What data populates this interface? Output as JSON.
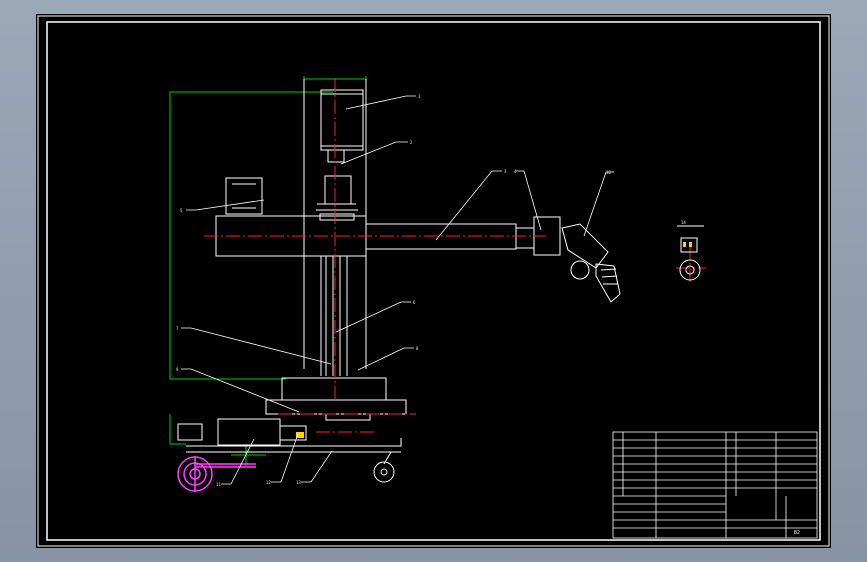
{
  "drawing": {
    "background_color": "#000000",
    "frame_color": "#ffffff",
    "outline_color": "#ffffff",
    "centerline_color": "#ff2020",
    "dimension_color": "#00cc00",
    "accent_color": "#ffd700",
    "wheel_color": "#ff40ff",
    "leader_labels": [
      "1",
      "2",
      "3",
      "4",
      "10",
      "5",
      "6",
      "7",
      "8",
      "9",
      "11",
      "12",
      "13",
      "14"
    ],
    "title_block": {
      "sheet_label": "B2"
    }
  }
}
